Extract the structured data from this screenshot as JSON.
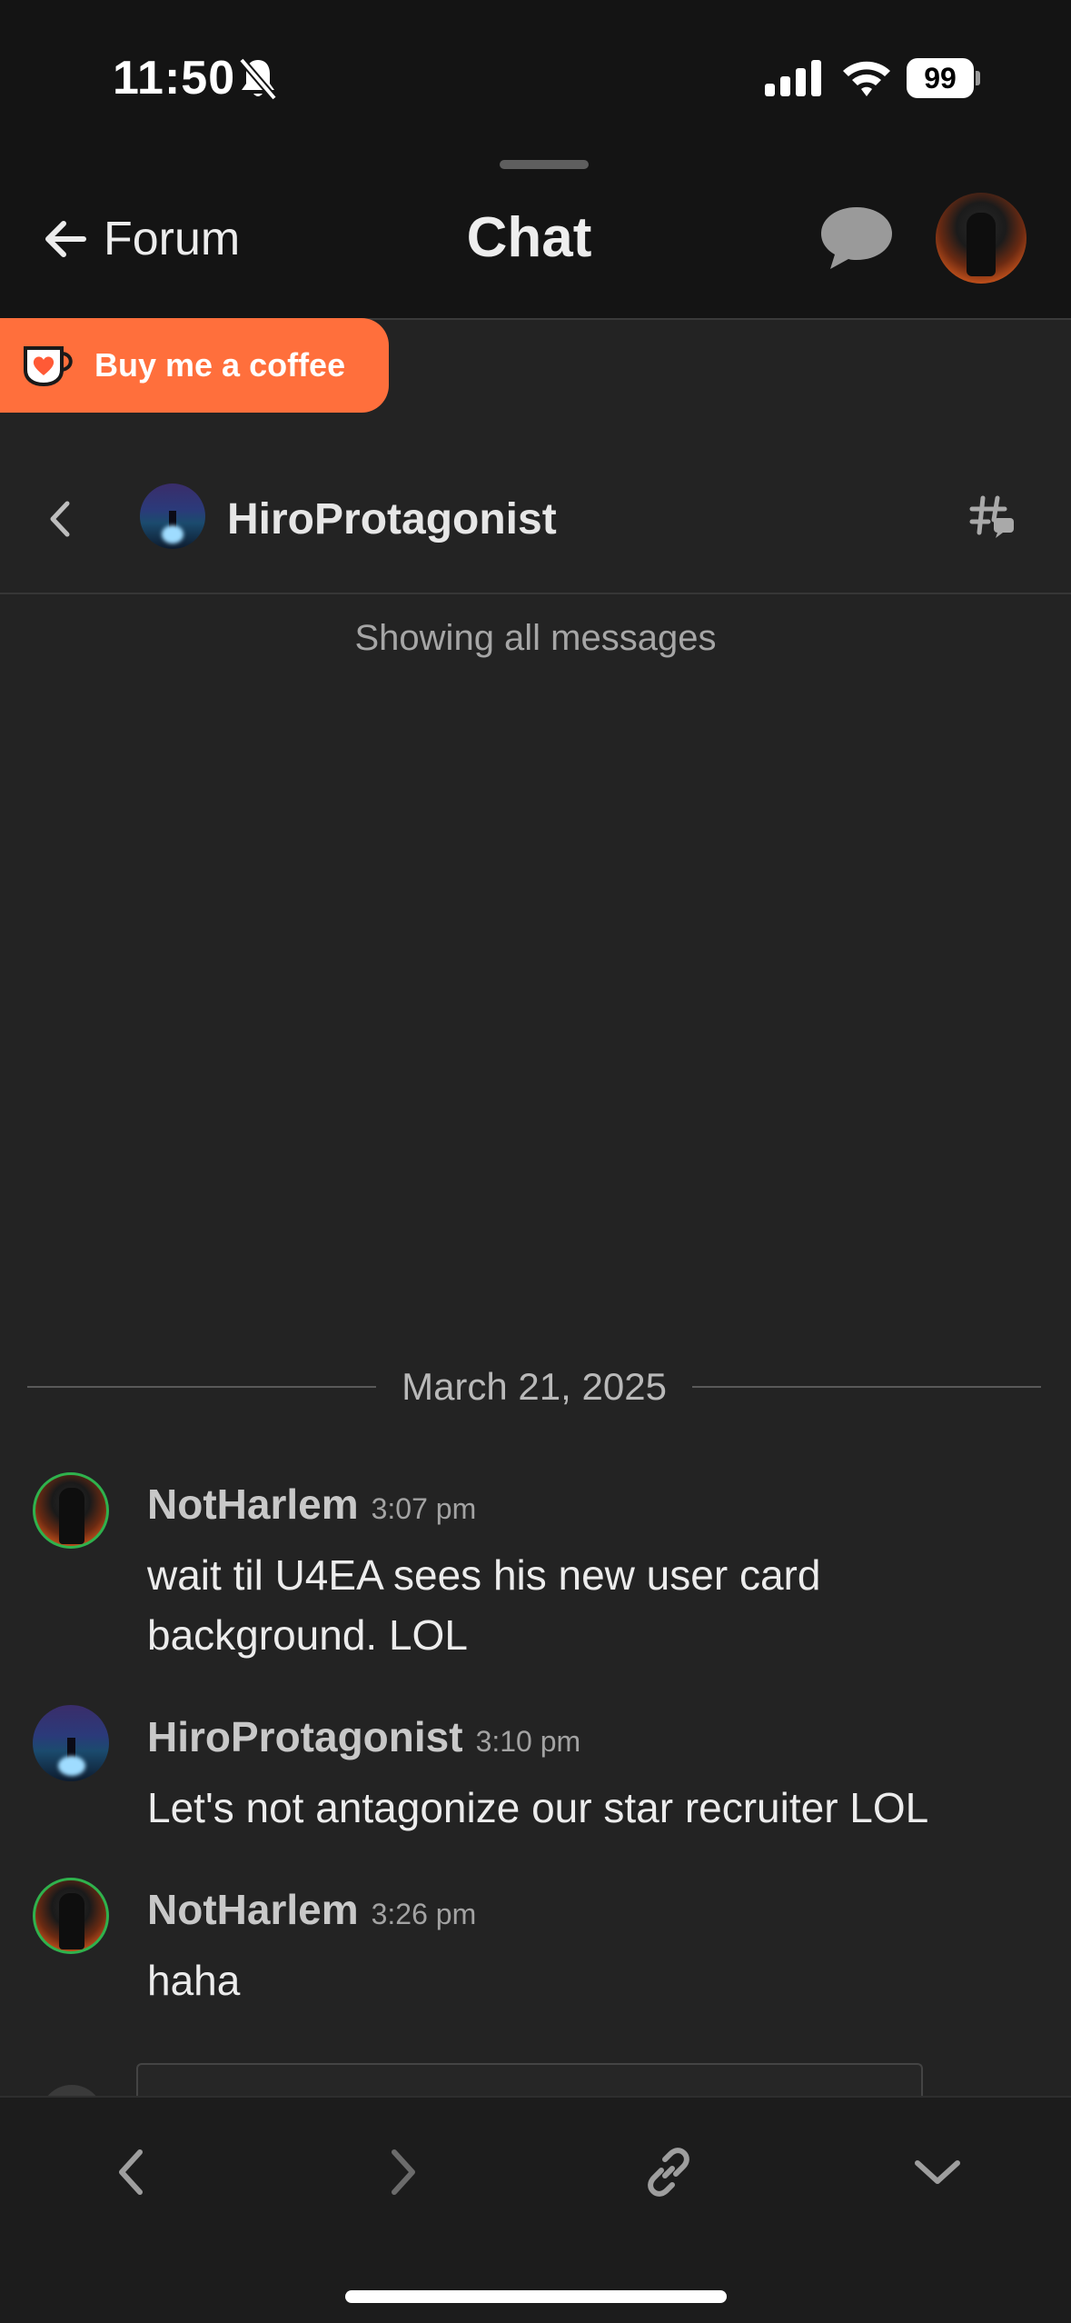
{
  "status_bar": {
    "time": "11:50",
    "battery": "99"
  },
  "header": {
    "back_label": "Forum",
    "title": "Chat"
  },
  "promo": {
    "label": "Buy me a coffee"
  },
  "channel": {
    "name": "HiroProtagonist"
  },
  "info": {
    "text": "Showing all messages"
  },
  "date_divider": "March 21, 2025",
  "messages": [
    {
      "author": "NotHarlem",
      "time": "3:07 pm",
      "text": "wait til U4EA sees his new user card background. LOL"
    },
    {
      "author": "HiroProtagonist",
      "time": "3:10 pm",
      "text": "Let's not antagonize our star recruiter LOL"
    },
    {
      "author": "NotHarlem",
      "time": "3:26 pm",
      "text": "haha"
    }
  ],
  "colors": {
    "accent_orange": "#ff6f3c",
    "online_ring": "#2fb24d",
    "background": "#232323"
  },
  "icons": [
    "bell-slash-icon",
    "signal-icon",
    "wifi-icon",
    "battery-icon",
    "arrow-left-icon",
    "chat-bubble-icon",
    "coffee-cup-icon",
    "chevron-left-icon",
    "thread-icon",
    "chevron-right-icon",
    "link-icon",
    "chevron-down-icon"
  ]
}
